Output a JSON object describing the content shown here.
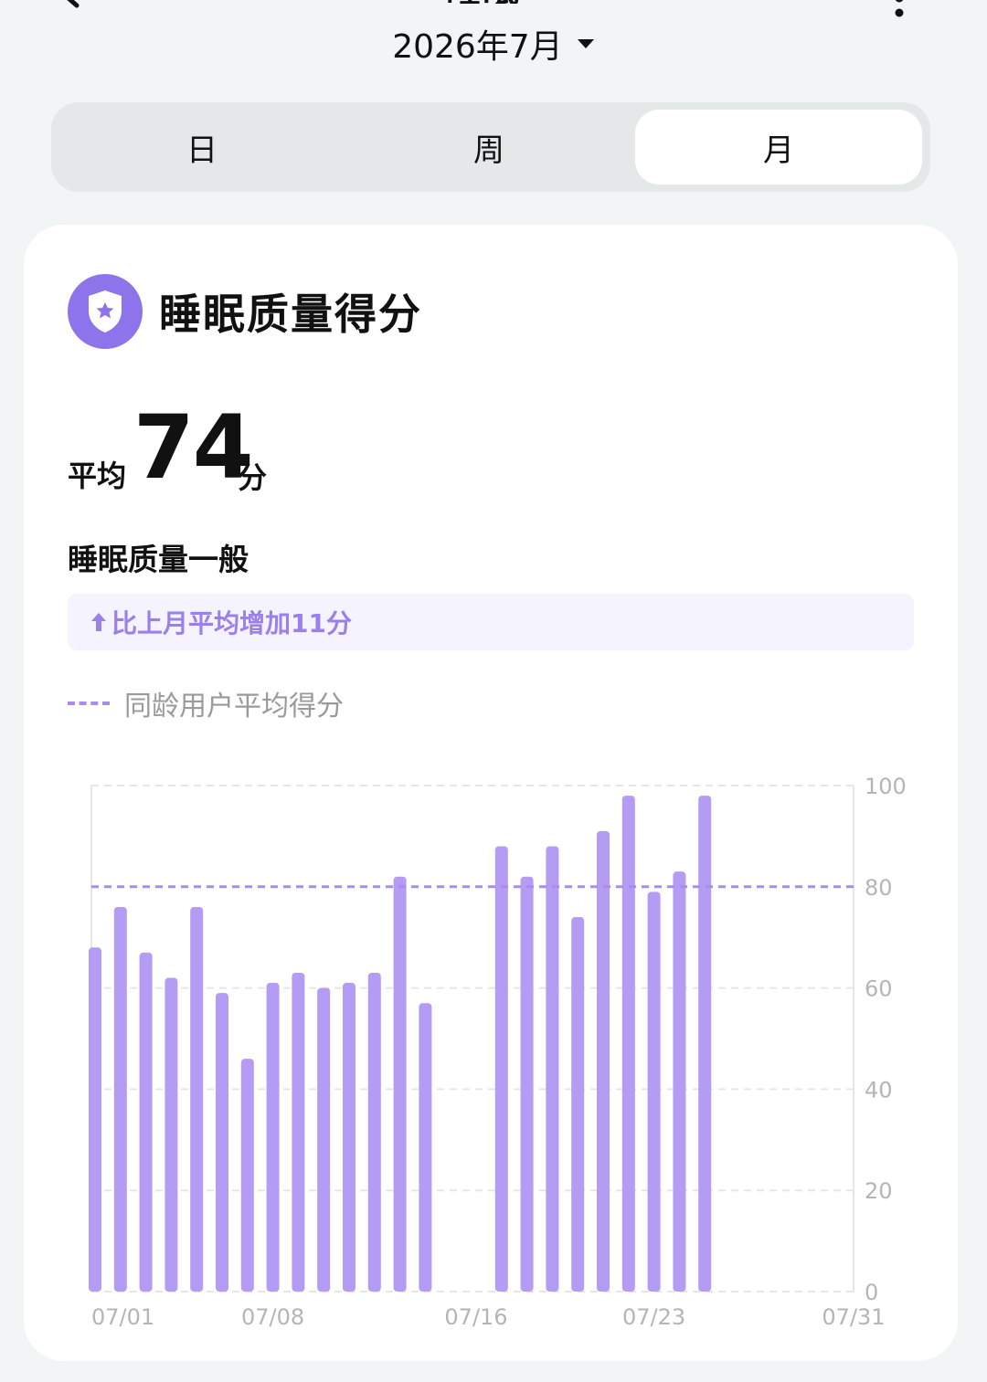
{
  "header": {
    "title_partial": "睡眠",
    "month": "2026年7月"
  },
  "tabs": [
    {
      "label": "日",
      "active": false
    },
    {
      "label": "周",
      "active": false
    },
    {
      "label": "月",
      "active": true
    }
  ],
  "card": {
    "title": "睡眠质量得分",
    "avg_label": "平均",
    "avg_value": "74",
    "avg_unit": "分",
    "quality": "睡眠质量一般",
    "compare": "比上月平均增加11分",
    "legend": "同龄用户平均得分"
  },
  "colors": {
    "bar": "#b49bf4",
    "reference_line": "#a88cf0",
    "accent_text": "#9a80ec",
    "shield": "#8e74ea"
  },
  "chart_data": {
    "type": "bar",
    "x": [
      "07/01",
      "07/02",
      "07/03",
      "07/04",
      "07/05",
      "07/06",
      "07/07",
      "07/08",
      "07/09",
      "07/10",
      "07/11",
      "07/12",
      "07/13",
      "07/14",
      "07/15",
      "07/16",
      "07/17",
      "07/18",
      "07/19",
      "07/20",
      "07/21",
      "07/22",
      "07/23",
      "07/24",
      "07/25",
      "07/26",
      "07/27",
      "07/28",
      "07/29",
      "07/30",
      "07/31"
    ],
    "values": [
      68,
      76,
      67,
      62,
      76,
      59,
      46,
      61,
      63,
      60,
      61,
      63,
      82,
      57,
      null,
      null,
      88,
      82,
      88,
      74,
      91,
      98,
      79,
      83,
      98,
      null,
      null,
      null,
      null,
      null,
      null
    ],
    "x_tick_labels": [
      "07/01",
      "07/08",
      "07/16",
      "07/23",
      "07/31"
    ],
    "y_ticks": [
      0,
      20,
      40,
      60,
      80,
      100
    ],
    "ylim": [
      0,
      100
    ],
    "reference_line": {
      "value": 80,
      "label": "同龄用户平均得分",
      "style": "dashed"
    },
    "y_axis_position": "right",
    "grid": true
  }
}
